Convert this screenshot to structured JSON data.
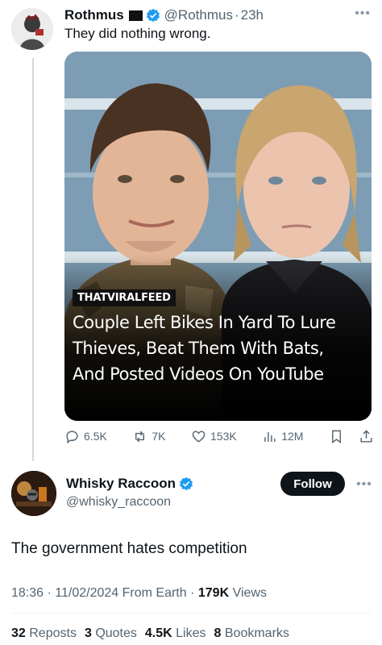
{
  "parent_tweet": {
    "display_name": "Rothmus",
    "handle": "@Rothmus",
    "time": "23h",
    "text": "They did nothing wrong.",
    "media": {
      "source_tag": "THATVIRALFEED",
      "headline": "Couple Left Bikes In Yard To Lure Thieves, Beat Them With Bats, And Posted Videos On YouTube"
    },
    "actions": {
      "replies": "6.5K",
      "reposts": "7K",
      "likes": "153K",
      "views": "12M"
    }
  },
  "quote_tweet": {
    "display_name": "Whisky Raccoon",
    "handle": "@whisky_raccoon",
    "follow_label": "Follow",
    "text": "The government hates competition",
    "meta": {
      "time": "18:36",
      "date": "11/02/2024",
      "source": "From Earth",
      "views_count": "179K",
      "views_label": "Views"
    },
    "stats": {
      "reposts_count": "32",
      "reposts_label": "Reposts",
      "quotes_count": "3",
      "quotes_label": "Quotes",
      "likes_count": "4.5K",
      "likes_label": "Likes",
      "bookmarks_count": "8",
      "bookmarks_label": "Bookmarks"
    }
  },
  "colors": {
    "text_primary": "#0f1419",
    "text_secondary": "#536471",
    "verified_blue": "#1d9bf0",
    "thread_line": "#cfd9de"
  },
  "icons": [
    "reply-icon",
    "repost-icon",
    "like-icon",
    "views-icon",
    "bookmark-icon",
    "share-icon",
    "verified-icon",
    "flag-icon",
    "more-icon"
  ]
}
